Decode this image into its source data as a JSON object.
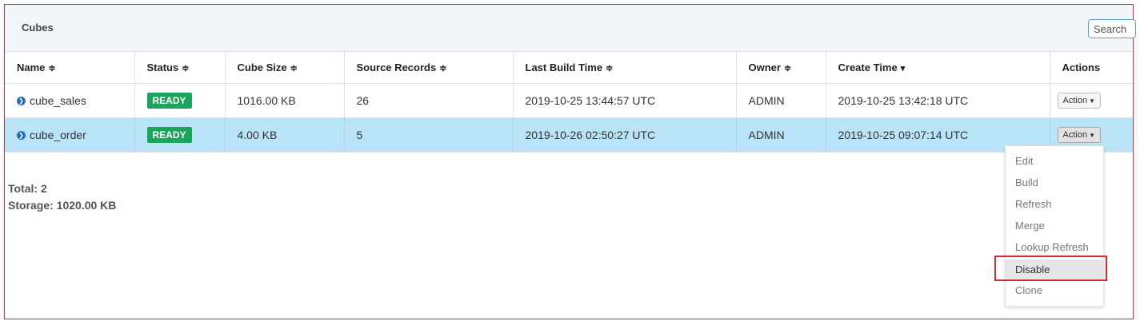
{
  "panel": {
    "title": "Cubes",
    "search_placeholder": "Search"
  },
  "table": {
    "columns": [
      {
        "label": "Name",
        "sort_icon": "≑"
      },
      {
        "label": "Status",
        "sort_icon": "≑"
      },
      {
        "label": "Cube Size",
        "sort_icon": "≑"
      },
      {
        "label": "Source Records",
        "sort_icon": "≑"
      },
      {
        "label": "Last Build Time",
        "sort_icon": "≑"
      },
      {
        "label": "Owner",
        "sort_icon": "≑"
      },
      {
        "label": "Create Time",
        "sort_icon": "▾"
      },
      {
        "label": "Actions",
        "sort_icon": ""
      }
    ],
    "rows": [
      {
        "name": "cube_sales",
        "status": "READY",
        "size": "1016.00 KB",
        "records": "26",
        "last_build": "2019-10-25 13:44:57 UTC",
        "owner": "ADMIN",
        "create_time": "2019-10-25 13:42:18 UTC",
        "action": "Action"
      },
      {
        "name": "cube_order",
        "status": "READY",
        "size": "4.00 KB",
        "records": "5",
        "last_build": "2019-10-26 02:50:27 UTC",
        "owner": "ADMIN",
        "create_time": "2019-10-25 09:07:14 UTC",
        "action": "Action"
      }
    ]
  },
  "totals": {
    "total": "Total: 2",
    "storage": "Storage: 1020.00 KB"
  },
  "action_menu": {
    "items": [
      "Edit",
      "Build",
      "Refresh",
      "Merge",
      "Lookup Refresh",
      "Disable",
      "Clone"
    ],
    "highlighted": "Disable"
  },
  "colors": {
    "ready_badge": "#1aa65a",
    "selected_row": "#b9e4f7",
    "highlight_border": "#d9282f"
  },
  "icons": {
    "expand": "chevron-right-circle-icon",
    "caret": "caret-down-icon",
    "sort": "sort-icon"
  }
}
